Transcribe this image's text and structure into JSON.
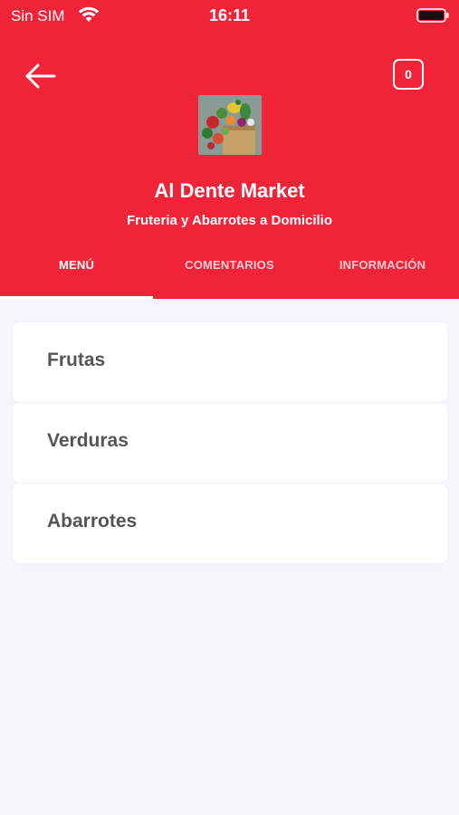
{
  "status_bar": {
    "carrier": "Sin SIM",
    "time": "16:11",
    "wifi_icon": "wifi-icon",
    "battery_icon": "battery-icon"
  },
  "header": {
    "back_icon": "arrow-left-icon",
    "cart_count": "0",
    "store_name": "Al Dente Market",
    "store_subtitle": "Fruteria y Abarrotes a Domicilio",
    "background_color": "#f12339"
  },
  "tabs": [
    {
      "label": "MENÚ",
      "active": true
    },
    {
      "label": "COMENTARIOS",
      "active": false
    },
    {
      "label": "INFORMACIÓN",
      "active": false
    }
  ],
  "menu": {
    "categories": [
      {
        "label": "Frutas"
      },
      {
        "label": "Verduras"
      },
      {
        "label": "Abarrotes"
      }
    ]
  }
}
